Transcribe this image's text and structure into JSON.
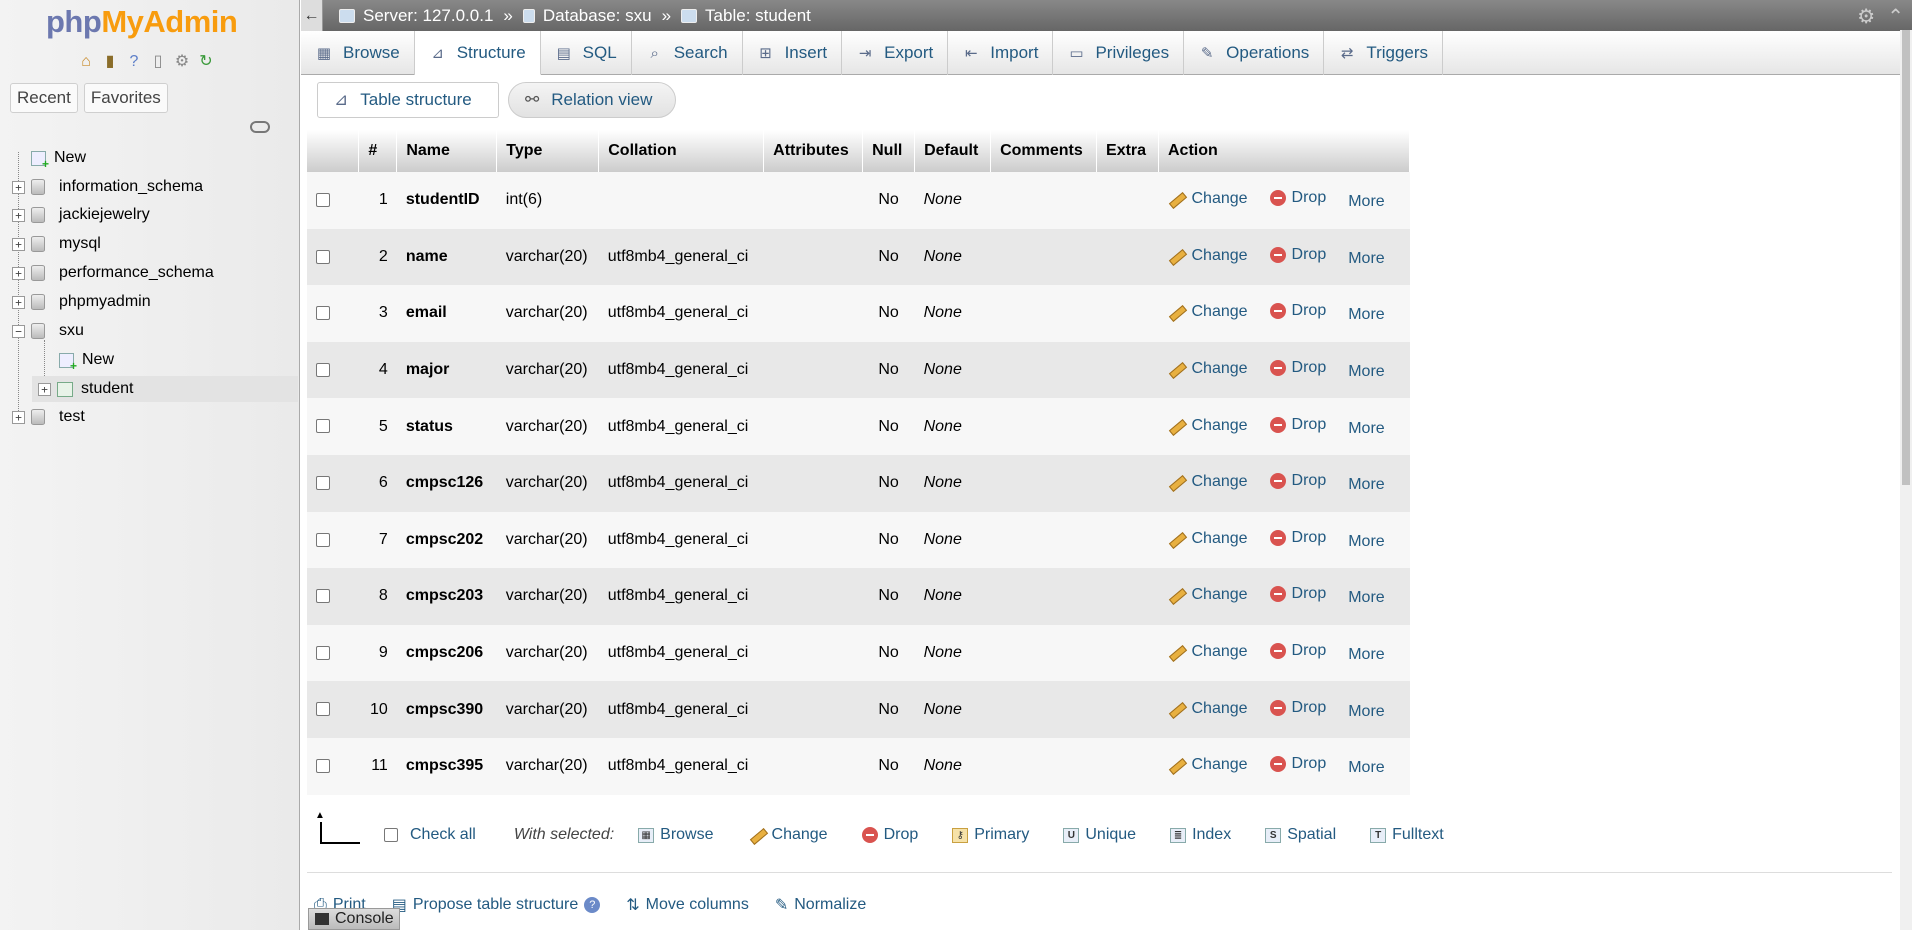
{
  "nav": {
    "logo": {
      "php": "php",
      "my": "My",
      "admin": "Admin"
    },
    "quick_icons": [
      "home-icon",
      "logout-icon",
      "help-icon",
      "docs-icon",
      "settings-icon",
      "reload-icon"
    ],
    "tabs": [
      "Recent",
      "Favorites"
    ],
    "tree": [
      {
        "label": "New",
        "type": "new",
        "expander": ""
      },
      {
        "label": "information_schema",
        "type": "db",
        "expander": "+"
      },
      {
        "label": "jackiejewelry",
        "type": "db",
        "expander": "+"
      },
      {
        "label": "mysql",
        "type": "db",
        "expander": "+"
      },
      {
        "label": "performance_schema",
        "type": "db",
        "expander": "+"
      },
      {
        "label": "phpmyadmin",
        "type": "db",
        "expander": "+"
      },
      {
        "label": "sxu",
        "type": "db",
        "expander": "−"
      },
      {
        "label": "New",
        "type": "new"
      },
      {
        "label": "student",
        "type": "table",
        "expander": "+"
      },
      {
        "label": "test",
        "type": "db",
        "expander": "+"
      }
    ]
  },
  "breadcrumb": {
    "server": "Server: 127.0.0.1",
    "database": "Database: sxu",
    "table": "Table: student",
    "separator": "»"
  },
  "menu_tabs": [
    "Browse",
    "Structure",
    "SQL",
    "Search",
    "Insert",
    "Export",
    "Import",
    "Privileges",
    "Operations",
    "Triggers"
  ],
  "subtabs": {
    "table_structure": "Table structure",
    "relation_view": "Relation view"
  },
  "table": {
    "headers": [
      "#",
      "Name",
      "Type",
      "Collation",
      "Attributes",
      "Null",
      "Default",
      "Comments",
      "Extra",
      "Action"
    ],
    "rows": [
      {
        "num": "1",
        "name": "studentID",
        "type": "int(6)",
        "collation": "",
        "null": "No",
        "default": "None"
      },
      {
        "num": "2",
        "name": "name",
        "type": "varchar(20)",
        "collation": "utf8mb4_general_ci",
        "null": "No",
        "default": "None"
      },
      {
        "num": "3",
        "name": "email",
        "type": "varchar(20)",
        "collation": "utf8mb4_general_ci",
        "null": "No",
        "default": "None"
      },
      {
        "num": "4",
        "name": "major",
        "type": "varchar(20)",
        "collation": "utf8mb4_general_ci",
        "null": "No",
        "default": "None"
      },
      {
        "num": "5",
        "name": "status",
        "type": "varchar(20)",
        "collation": "utf8mb4_general_ci",
        "null": "No",
        "default": "None"
      },
      {
        "num": "6",
        "name": "cmpsc126",
        "type": "varchar(20)",
        "collation": "utf8mb4_general_ci",
        "null": "No",
        "default": "None"
      },
      {
        "num": "7",
        "name": "cmpsc202",
        "type": "varchar(20)",
        "collation": "utf8mb4_general_ci",
        "null": "No",
        "default": "None"
      },
      {
        "num": "8",
        "name": "cmpsc203",
        "type": "varchar(20)",
        "collation": "utf8mb4_general_ci",
        "null": "No",
        "default": "None"
      },
      {
        "num": "9",
        "name": "cmpsc206",
        "type": "varchar(20)",
        "collation": "utf8mb4_general_ci",
        "null": "No",
        "default": "None"
      },
      {
        "num": "10",
        "name": "cmpsc390",
        "type": "varchar(20)",
        "collation": "utf8mb4_general_ci",
        "null": "No",
        "default": "None"
      },
      {
        "num": "11",
        "name": "cmpsc395",
        "type": "varchar(20)",
        "collation": "utf8mb4_general_ci",
        "null": "No",
        "default": "None"
      }
    ],
    "actions": {
      "change": "Change",
      "drop": "Drop",
      "more": "More"
    }
  },
  "bulk": {
    "check_all": "Check all",
    "with_selected": "With selected:",
    "actions": [
      "Browse",
      "Change",
      "Drop",
      "Primary",
      "Unique",
      "Index",
      "Spatial",
      "Fulltext"
    ]
  },
  "bottom_links": {
    "print": "Print",
    "propose": "Propose table structure",
    "move_columns": "Move columns",
    "normalize": "Normalize"
  },
  "console": {
    "label": "Console"
  },
  "colors": {
    "link": "#235a81",
    "accent_orange": "#f89c0e",
    "logo_blue": "#6c78af",
    "drop_red": "#d9534f"
  }
}
